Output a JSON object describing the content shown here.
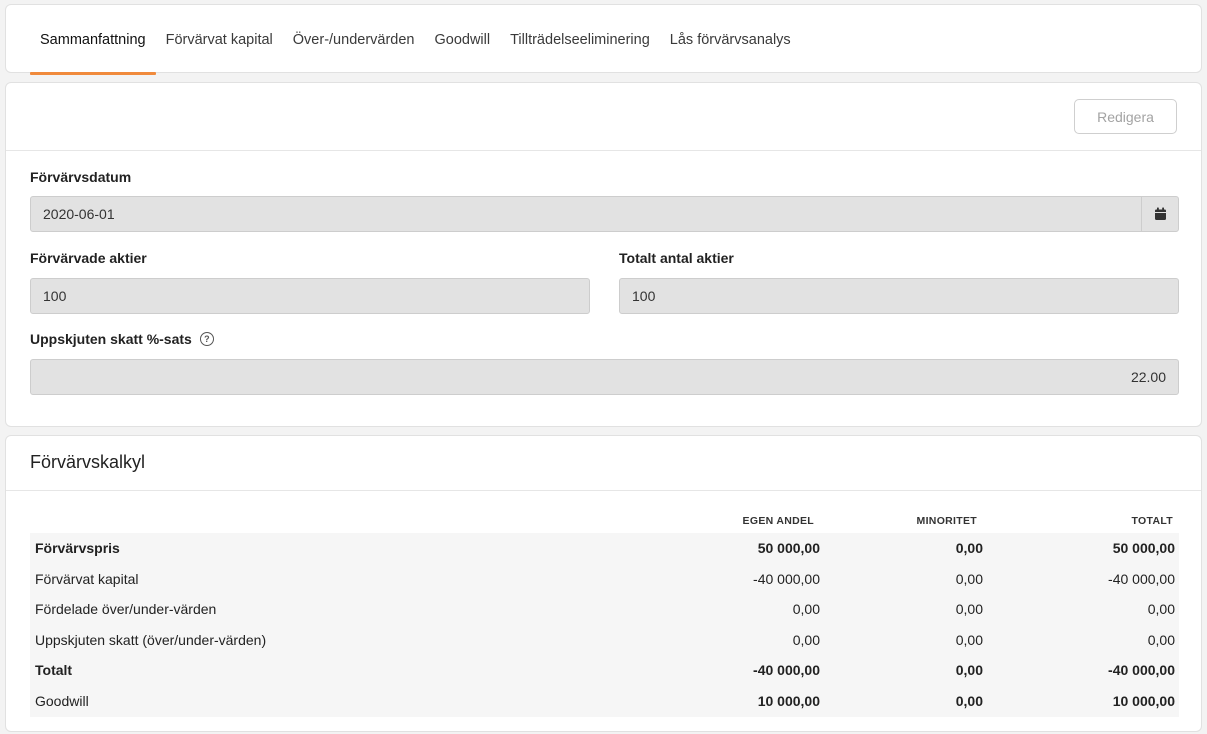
{
  "tabs": [
    {
      "label": "Sammanfattning",
      "active": true
    },
    {
      "label": "Förvärvat kapital",
      "active": false
    },
    {
      "label": "Över-/undervärden",
      "active": false
    },
    {
      "label": "Goodwill",
      "active": false
    },
    {
      "label": "Tillträdelseeliminering",
      "active": false
    },
    {
      "label": "Lås förvärvsanalys",
      "active": false
    }
  ],
  "form": {
    "edit_label": "Redigera",
    "acquisition_date_label": "Förvärvsdatum",
    "acquisition_date_value": "2020-06-01",
    "acquired_shares_label": "Förvärvade aktier",
    "acquired_shares_value": "100",
    "total_shares_label": "Totalt antal aktier",
    "total_shares_value": "100",
    "deferred_tax_label": "Uppskjuten skatt %-sats",
    "deferred_tax_value": "22.00"
  },
  "calc": {
    "title": "Förvärvskalkyl",
    "columns": [
      "EGEN ANDEL",
      "MINORITET",
      "TOTALT"
    ],
    "rows": [
      {
        "label": "Förvärvspris",
        "own": "50 000,00",
        "minority": "0,00",
        "total": "50 000,00",
        "bold": true
      },
      {
        "label": "Förvärvat kapital",
        "own": "-40 000,00",
        "minority": "0,00",
        "total": "-40 000,00",
        "bold": false
      },
      {
        "label": "Fördelade över/under-värden",
        "own": "0,00",
        "minority": "0,00",
        "total": "0,00",
        "bold": false
      },
      {
        "label": "Uppskjuten skatt (över/under-värden)",
        "own": "0,00",
        "minority": "0,00",
        "total": "0,00",
        "bold": false
      },
      {
        "label": "Totalt",
        "own": "-40 000,00",
        "minority": "0,00",
        "total": "-40 000,00",
        "bold": true
      },
      {
        "label": "Goodwill",
        "own": "10 000,00",
        "minority": "0,00",
        "total": "10 000,00",
        "bold": false,
        "values_bold": true
      }
    ]
  },
  "colors": {
    "accent": "#f08a3c"
  },
  "icons": {
    "calendar": "calendar-icon",
    "help": "help-icon"
  }
}
